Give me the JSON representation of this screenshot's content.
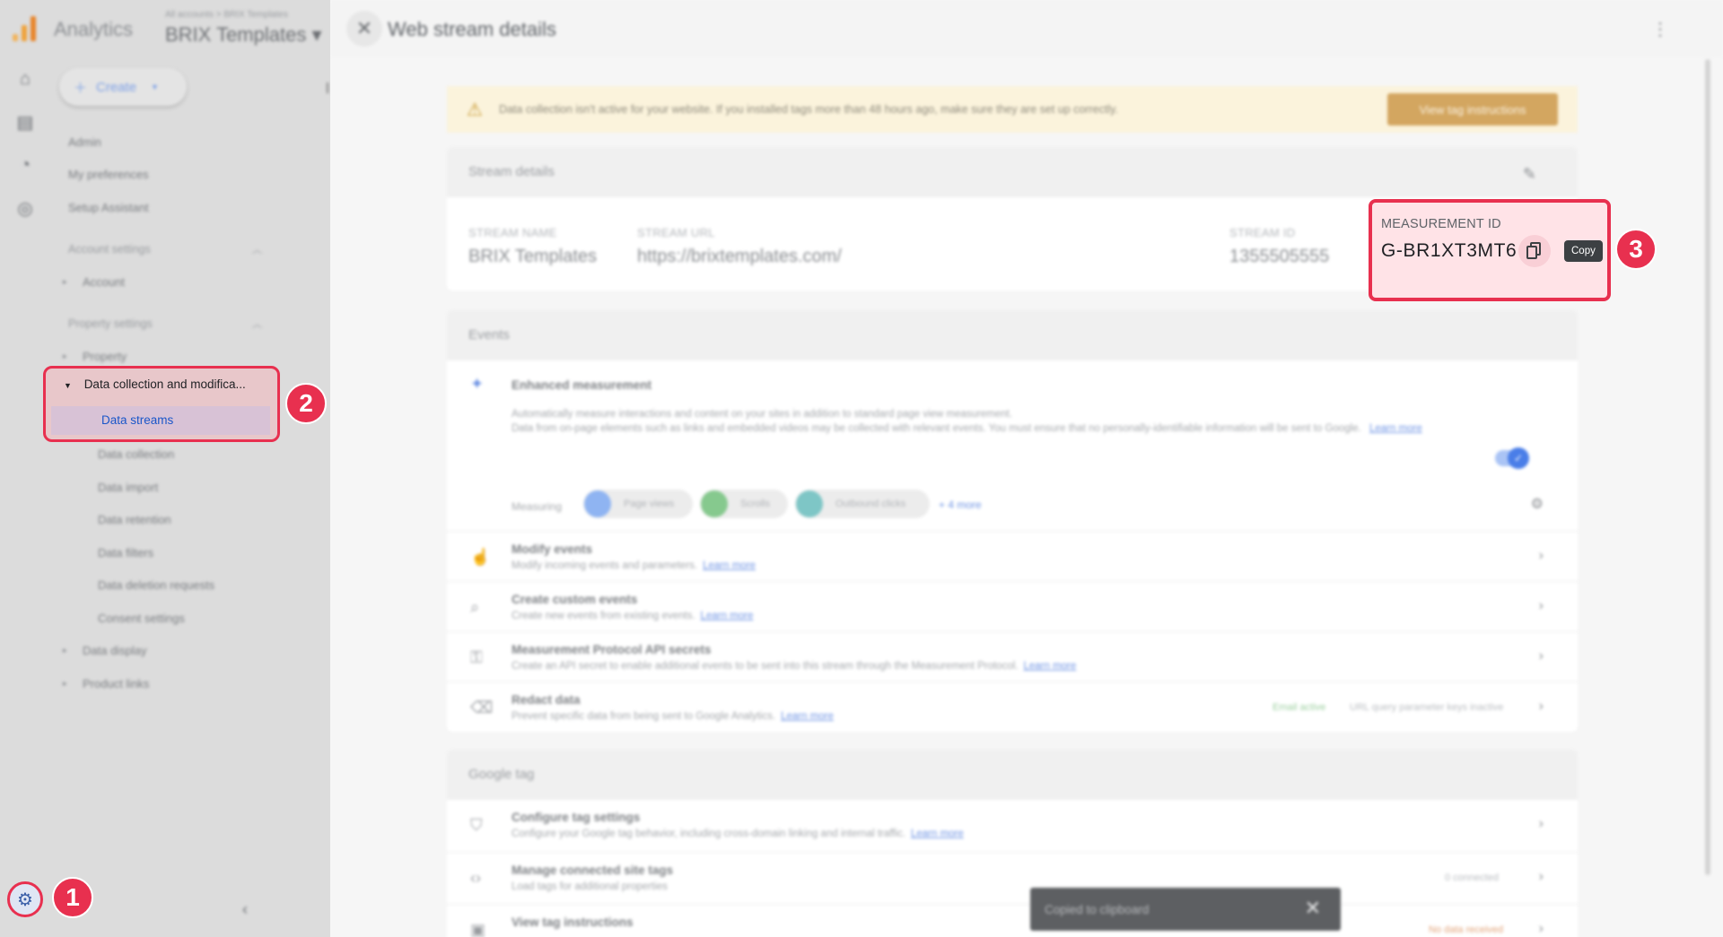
{
  "app": {
    "name": "Analytics",
    "breadcrumb": "All accounts > BRIX Templates",
    "property_selector": "BRIX Templates ▾",
    "create_label": "Create"
  },
  "nav": {
    "items": [
      {
        "label": "Admin"
      },
      {
        "label": "My preferences"
      },
      {
        "label": "Setup Assistant"
      }
    ],
    "account_settings": "Account settings",
    "account": "Account",
    "property_settings": "Property settings",
    "property": "Property",
    "data_collection_group": "Data collection and modifica...",
    "data_streams": "Data streams",
    "sub_items": [
      {
        "label": "Data collection"
      },
      {
        "label": "Data import"
      },
      {
        "label": "Data retention"
      },
      {
        "label": "Data filters"
      },
      {
        "label": "Data deletion requests"
      },
      {
        "label": "Consent settings"
      }
    ],
    "data_display": "Data display",
    "product_links": "Product links"
  },
  "drawer": {
    "title": "Web stream details",
    "warning": {
      "text": "Data collection isn't active for your website. If you installed tags more than 48 hours ago, make sure they are set up correctly.",
      "button": "View tag instructions"
    },
    "stream_details": {
      "heading": "Stream details",
      "stream_name_label": "STREAM NAME",
      "stream_name": "BRIX Templates",
      "stream_url_label": "STREAM URL",
      "stream_url": "https://brixtemplates.com/",
      "stream_id_label": "STREAM ID",
      "stream_id": "1355505555",
      "measurement_id_label": "MEASUREMENT ID",
      "measurement_id": "G-BR1XT3MT6",
      "copy_tooltip": "Copy"
    },
    "events": {
      "heading": "Events",
      "enhanced_title": "Enhanced measurement",
      "enhanced_desc_1": "Automatically measure interactions and content on your sites in addition to standard page view measurement.",
      "enhanced_desc_2": "Data from on-page elements such as links and embedded videos may be collected with relevant events. You must ensure that no personally-identifiable information will be sent to Google.",
      "learn_more": "Learn more",
      "measuring_label": "Measuring",
      "chips": [
        {
          "label": "Page views",
          "color": "#8fb4f2"
        },
        {
          "label": "Scrolls",
          "color": "#86c98e"
        },
        {
          "label": "Outbound clicks",
          "color": "#7ec6c6"
        }
      ],
      "more": "+ 4 more",
      "rows": [
        {
          "title": "Modify events",
          "desc": "Modify incoming events and parameters.",
          "link": "Learn more"
        },
        {
          "title": "Create custom events",
          "desc": "Create new events from existing events.",
          "link": "Learn more"
        },
        {
          "title": "Measurement Protocol API secrets",
          "desc": "Create an API secret to enable additional events to be sent into this stream through the Measurement Protocol.",
          "link": "Learn more"
        },
        {
          "title": "Redact data",
          "desc": "Prevent specific data from being sent to Google Analytics.",
          "link": "Learn more",
          "tag1": "Email active",
          "tag2": "URL query parameter keys inactive"
        }
      ]
    },
    "google_tag": {
      "heading": "Google tag",
      "rows": [
        {
          "title": "Configure tag settings",
          "desc": "Configure your Google tag behavior, including cross-domain linking and internal traffic.",
          "link": "Learn more"
        },
        {
          "title": "Manage connected site tags",
          "desc": "Load tags for additional properties",
          "right": "0 connected"
        },
        {
          "title": "View tag instructions",
          "desc": "",
          "right": "No data received"
        }
      ]
    },
    "toast": "Copied to clipboard"
  },
  "annotations": {
    "badge1": "1",
    "badge2": "2",
    "badge3": "3",
    "color": "#e8304f"
  }
}
